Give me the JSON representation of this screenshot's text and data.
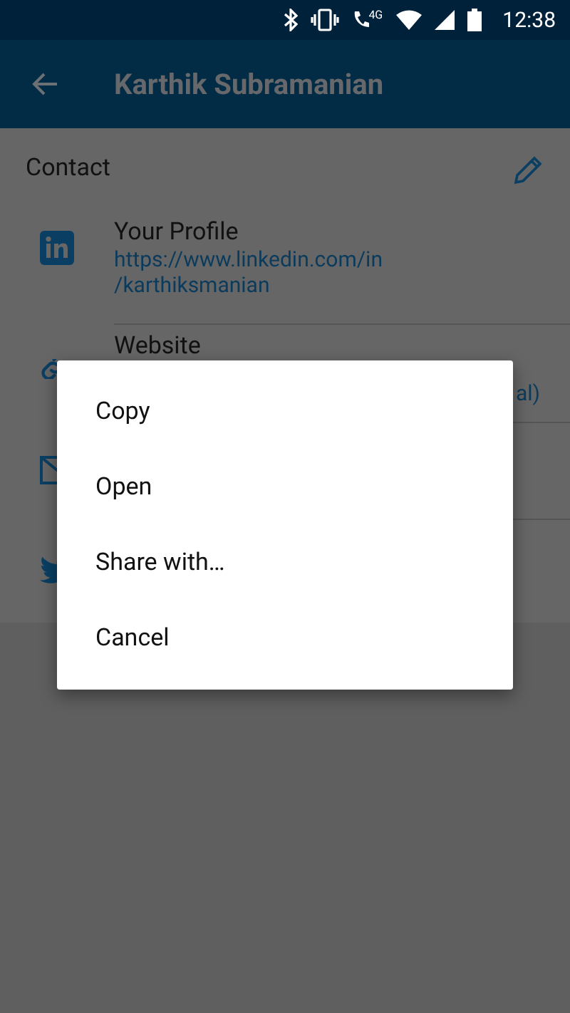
{
  "status_bar": {
    "network": "4G",
    "time": "12:38"
  },
  "app_bar": {
    "title": "Karthik Subramanian"
  },
  "contact": {
    "heading": "Contact",
    "rows": [
      {
        "kind": "linkedin",
        "title": "Your Profile",
        "value": "https://www.linkedin.com/in\n/karthiksmanian"
      },
      {
        "kind": "website",
        "title": "Website",
        "value": "al)"
      },
      {
        "kind": "email"
      },
      {
        "kind": "twitter"
      }
    ]
  },
  "menu": {
    "items": [
      "Copy",
      "Open",
      "Share with…",
      "Cancel"
    ]
  }
}
